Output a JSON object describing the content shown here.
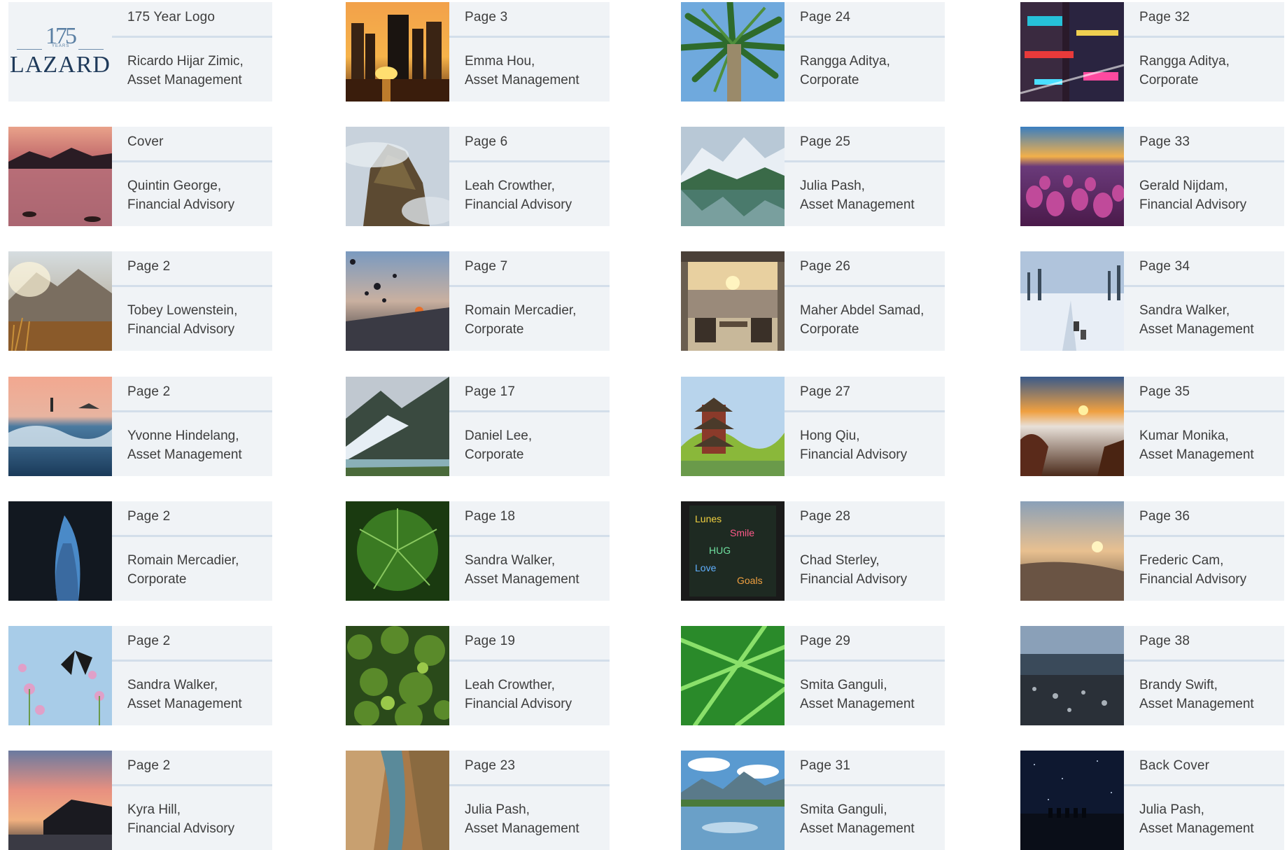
{
  "logo": {
    "number": "175",
    "years_text": "YEARS",
    "wordmark": "LAZARD"
  },
  "cards": [
    {
      "label": "175 Year Logo",
      "name": "Ricardo Hijar Zimic,",
      "dept": "Asset Management",
      "img": "logo"
    },
    {
      "label": "Page 3",
      "name": "Emma Hou,",
      "dept": "Asset Management",
      "img": "city-sunset"
    },
    {
      "label": "Page 24",
      "name": "Rangga Aditya,",
      "dept": "Corporate",
      "img": "palm"
    },
    {
      "label": "Page 32",
      "name": "Rangga Aditya,",
      "dept": "Corporate",
      "img": "neon-city"
    },
    {
      "label": "Cover",
      "name": "Quintin George,",
      "dept": "Financial Advisory",
      "img": "lake-dusk"
    },
    {
      "label": "Page 6",
      "name": "Leah Crowther,",
      "dept": "Financial Advisory",
      "img": "mist-rock"
    },
    {
      "label": "Page 25",
      "name": "Julia Pash,",
      "dept": "Asset Management",
      "img": "alpine-lake"
    },
    {
      "label": "Page 33",
      "name": "Gerald Nijdam,",
      "dept": "Financial Advisory",
      "img": "tulips"
    },
    {
      "label": "Page 2",
      "name": "Tobey Lowenstein,",
      "dept": "Financial Advisory",
      "img": "mountain-haze"
    },
    {
      "label": "Page 7",
      "name": "Romain Mercadier,",
      "dept": "Corporate",
      "img": "balloons"
    },
    {
      "label": "Page 26",
      "name": "Maher Abdel Samad,",
      "dept": "Corporate",
      "img": "terrace-sea"
    },
    {
      "label": "Page 34",
      "name": "Sandra Walker,",
      "dept": "Asset Management",
      "img": "snow-sled"
    },
    {
      "label": "Page 2",
      "name": "Yvonne Hindelang,",
      "dept": "Asset Management",
      "img": "surf"
    },
    {
      "label": "Page 17",
      "name": "Daniel Lee,",
      "dept": "Corporate",
      "img": "glacier"
    },
    {
      "label": "Page 27",
      "name": "Hong Qiu,",
      "dept": "Financial Advisory",
      "img": "pagoda"
    },
    {
      "label": "Page 35",
      "name": "Kumar Monika,",
      "dept": "Asset Management",
      "img": "clouds-sunset"
    },
    {
      "label": "Page 2",
      "name": "Romain Mercadier,",
      "dept": "Corporate",
      "img": "sea-cave"
    },
    {
      "label": "Page 18",
      "name": "Sandra Walker,",
      "dept": "Asset Management",
      "img": "leaf"
    },
    {
      "label": "Page 28",
      "name": "Chad Sterley,",
      "dept": "Financial Advisory",
      "img": "chalkboard"
    },
    {
      "label": "Page 36",
      "name": "Frederic Cam,",
      "dept": "Financial Advisory",
      "img": "beach-sunset"
    },
    {
      "label": "Page 2",
      "name": "Sandra Walker,",
      "dept": "Asset Management",
      "img": "butterfly"
    },
    {
      "label": "Page 19",
      "name": "Leah Crowther,",
      "dept": "Financial Advisory",
      "img": "forest"
    },
    {
      "label": "Page 29",
      "name": "Smita Ganguli,",
      "dept": "Asset Management",
      "img": "ferns"
    },
    {
      "label": "Page 38",
      "name": "Brandy Swift,",
      "dept": "Asset Management",
      "img": "pebble-shore"
    },
    {
      "label": "Page 2",
      "name": "Kyra Hill,",
      "dept": "Financial Advisory",
      "img": "coast-sunset"
    },
    {
      "label": "Page 23",
      "name": "Julia Pash,",
      "dept": "Asset Management",
      "img": "canyon"
    },
    {
      "label": "Page 31",
      "name": "Smita Ganguli,",
      "dept": "Asset Management",
      "img": "mountain-reflect"
    },
    {
      "label": "Back Cover",
      "name": "Julia Pash,",
      "dept": "Asset Management",
      "img": "night-sky"
    }
  ]
}
